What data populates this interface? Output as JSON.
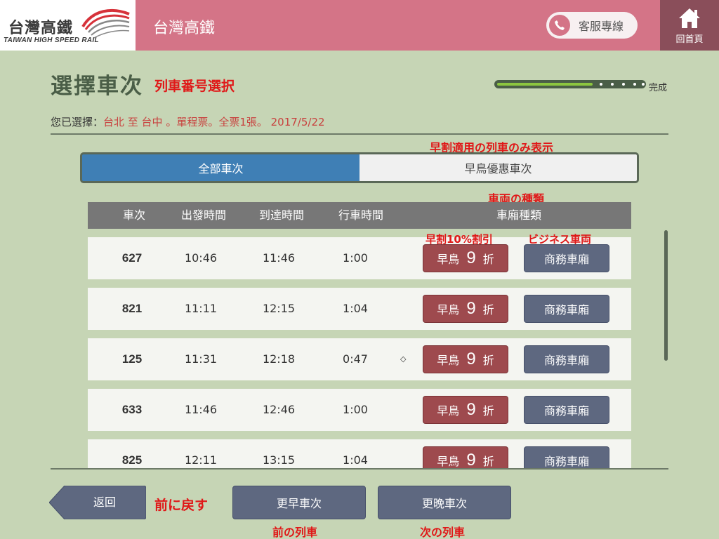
{
  "header": {
    "logo_zh": "台灣高鐵",
    "logo_en": "TAIWAN HIGH SPEED RAIL",
    "app_title": "台灣高鐵",
    "service_label": "客服專線",
    "home_label": "回首頁"
  },
  "page": {
    "title": "選擇車次",
    "title_note": "列車番号選択",
    "progress_label": "完成",
    "progress_fraction": 0.64,
    "selection_prefix": "您已選擇：",
    "selection_value": "台北 至 台中 。單程票。全票1張。 2017/5/22"
  },
  "tabs": {
    "note": "早割適用の列車のみ表示",
    "all_label": "全部車次",
    "early_label": "早鳥優惠車次",
    "active": "all"
  },
  "table": {
    "type_note": "車両の種類",
    "headers": {
      "train": "車次",
      "departure": "出發時間",
      "arrival": "到達時間",
      "duration": "行車時間",
      "car_type": "車廂種類"
    },
    "early_note": "早割10%割引",
    "business_note": "ビジネス車両",
    "rows": [
      {
        "train": "627",
        "departure": "10:46",
        "arrival": "11:46",
        "duration": "1:00",
        "marker": "",
        "early_label": "早鳥",
        "early_num": "9",
        "early_unit": "折",
        "business_label": "商務車廂"
      },
      {
        "train": "821",
        "departure": "11:11",
        "arrival": "12:15",
        "duration": "1:04",
        "marker": "",
        "early_label": "早鳥",
        "early_num": "9",
        "early_unit": "折",
        "business_label": "商務車廂"
      },
      {
        "train": "125",
        "departure": "11:31",
        "arrival": "12:18",
        "duration": "0:47",
        "marker": "◇",
        "early_label": "早鳥",
        "early_num": "9",
        "early_unit": "折",
        "business_label": "商務車廂"
      },
      {
        "train": "633",
        "departure": "11:46",
        "arrival": "12:46",
        "duration": "1:00",
        "marker": "",
        "early_label": "早鳥",
        "early_num": "9",
        "early_unit": "折",
        "business_label": "商務車廂"
      },
      {
        "train": "825",
        "departure": "12:11",
        "arrival": "13:15",
        "duration": "1:04",
        "marker": "",
        "early_label": "早鳥",
        "early_num": "9",
        "early_unit": "折",
        "business_label": "商務車廂"
      }
    ]
  },
  "footer": {
    "back_label": "返回",
    "back_note": "前に戻す",
    "earlier_label": "更早車次",
    "earlier_note": "前の列車",
    "later_label": "更晚車次",
    "later_note": "次の列車"
  },
  "icons": {
    "phone": "phone-icon",
    "home": "home-icon",
    "logo": "thsr-logo-icon"
  },
  "colors": {
    "header_pink": "#d47487",
    "home_bg": "#8a4e5a",
    "background": "#c6d5b5",
    "active_tab": "#3f7fb5",
    "early_button": "#9e4a4e",
    "business_button": "#5e6880",
    "note_red": "#e01818",
    "progress_green": "#8cc63f"
  }
}
